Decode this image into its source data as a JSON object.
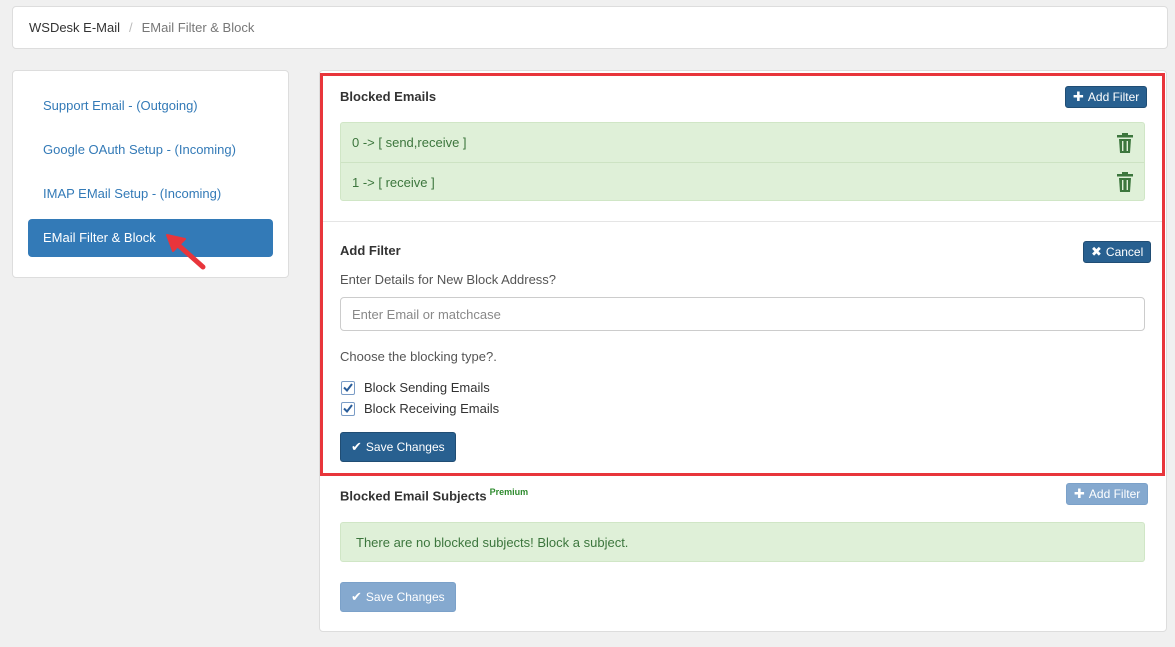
{
  "breadcrumb": {
    "root": "WSDesk E-Mail",
    "separator": "/",
    "current": "EMail Filter & Block"
  },
  "sidebar": {
    "items": [
      {
        "label": "Support Email - (Outgoing)",
        "active": false
      },
      {
        "label": "Google OAuth Setup - (Incoming)",
        "active": false
      },
      {
        "label": "IMAP EMail Setup - (Incoming)",
        "active": false
      },
      {
        "label": "EMail Filter & Block",
        "active": true
      }
    ]
  },
  "blocked_emails": {
    "title": "Blocked Emails",
    "add_filter_label": "Add Filter",
    "rows": [
      {
        "text": "0 -> [ send,receive ]"
      },
      {
        "text": "1 -> [ receive ]"
      }
    ]
  },
  "add_filter": {
    "title": "Add Filter",
    "cancel_label": "Cancel",
    "prompt": "Enter Details for New Block Address?",
    "input_placeholder": "Enter Email or matchcase",
    "input_value": "",
    "type_prompt": "Choose the blocking type?.",
    "checkboxes": [
      {
        "label": "Block Sending Emails",
        "checked": true
      },
      {
        "label": "Block Receiving Emails",
        "checked": true
      }
    ],
    "save_label": "Save Changes"
  },
  "blocked_subjects": {
    "title": "Blocked Email Subjects",
    "badge": "Premium",
    "add_filter_label": "Add Filter",
    "empty_message": "There are no blocked subjects! Block a subject.",
    "save_label": "Save Changes"
  },
  "colors": {
    "primary": "#337ab7",
    "success_bg": "#dff0d8",
    "success_text": "#3c763d",
    "highlight": "#e8353b",
    "trash": "#3c763d"
  }
}
